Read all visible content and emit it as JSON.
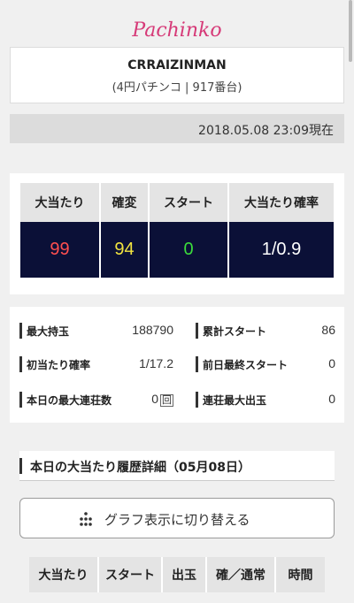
{
  "header": {
    "brand": "Pachinko"
  },
  "machine": {
    "name": "CRRAIZINMAN",
    "subtitle": "(4円パチンコ | 917番台)"
  },
  "timestamp": "2018.05.08 23:09現在",
  "stats": {
    "headers": [
      "大当たり",
      "確変",
      "スタート",
      "大当たり確率"
    ],
    "values": [
      "99",
      "94",
      "0",
      "1/0.9"
    ],
    "colors": [
      "#ff4f4f",
      "#f2e440",
      "#3cdc3c",
      "#ffffff"
    ]
  },
  "info": {
    "items": [
      {
        "label": "最大持玉",
        "value": "188790"
      },
      {
        "label": "累計スタート",
        "value": "86"
      },
      {
        "label": "初当たり確率",
        "value": "1/17.2"
      },
      {
        "label": "前日最終スタート",
        "value": "0"
      },
      {
        "label": "本日の最大連荘数",
        "value": "0",
        "unit": "回"
      },
      {
        "label": "連荘最大出玉",
        "value": "0"
      }
    ]
  },
  "history": {
    "title": "本日の大当たり履歴詳細（05月08日）",
    "graph_button": "グラフ表示に切り替える",
    "columns": [
      "大当たり",
      "スタート",
      "出玉",
      "確／通常",
      "時間"
    ]
  }
}
